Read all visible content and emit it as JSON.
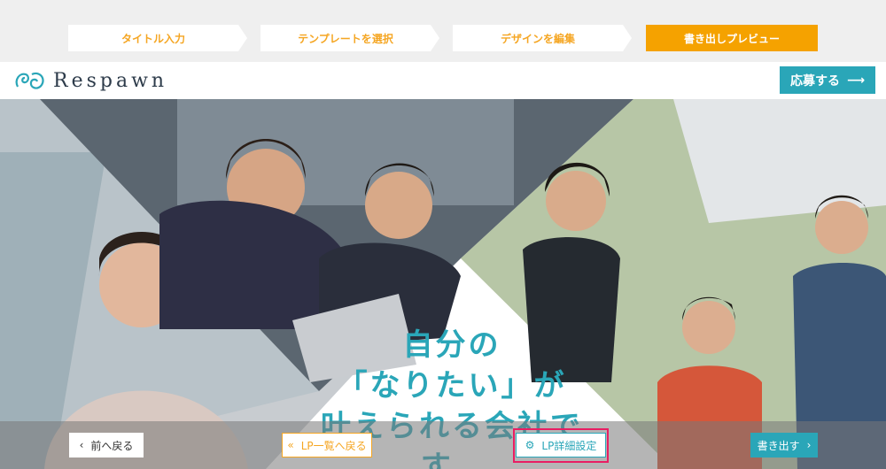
{
  "steps": [
    {
      "label": "タイトル入力"
    },
    {
      "label": "テンプレートを選択"
    },
    {
      "label": "デザインを編集"
    },
    {
      "label": "書き出しプレビュー"
    }
  ],
  "header": {
    "logo_text": "Respawn",
    "apply_label": "応募する",
    "apply_arrow": "⟶"
  },
  "hero": {
    "line1": "自分の",
    "line2": "「なりたい」が",
    "line3": "叶えられる会社です。"
  },
  "toolbar": {
    "prev_label": "前へ戻る",
    "list_label": "LP一覧へ戻る",
    "detail_label": "LP詳細設定",
    "export_label": "書き出す"
  },
  "colors": {
    "accent_orange": "#f5a200",
    "accent_teal": "#2aa6b8",
    "highlight": "#e91e63"
  }
}
